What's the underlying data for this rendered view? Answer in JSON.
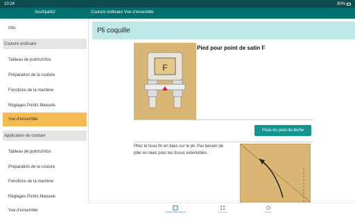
{
  "statusbar": {
    "time": "10:24",
    "battery": "30%"
  },
  "appbar": {
    "app_name": "AcuSpark2",
    "breadcrumb": "Couture ordinaire  Vue d'ensemble"
  },
  "sidebar": {
    "top_item": "Info.",
    "section1": "Couture ordinaire",
    "section1_items": [
      "Tableau de points/Infos",
      "Préparation de la couture",
      "Fonctions de la machine",
      "Réglages Points Manuels",
      "Vue d'ensemble"
    ],
    "section2": "Application de couture",
    "section2_items": [
      "Tableau de points/Infos",
      "Préparation de la couture",
      "Fonctions de la machine",
      "Réglages Points Manuels",
      "Vue d'ensemble"
    ]
  },
  "main": {
    "title": "Pli coquille",
    "foot_title": "Pied pour point de satin F",
    "foot_letter": "F",
    "foot_button": "Pose du pied-de-biche",
    "instructions": "Pliez le tissu fin en biais sur le pli. Pas besoin de plier en biais pour les tissus extensibles."
  },
  "bottomnav": {
    "items": [
      "Utilisation/Explications",
      "Personnel",
      "Options"
    ]
  },
  "colors": {
    "appbar": "#00706f",
    "statusbar": "#0d4d50",
    "header": "#bde8e6",
    "active": "#f5bb50",
    "button": "#12958f"
  }
}
